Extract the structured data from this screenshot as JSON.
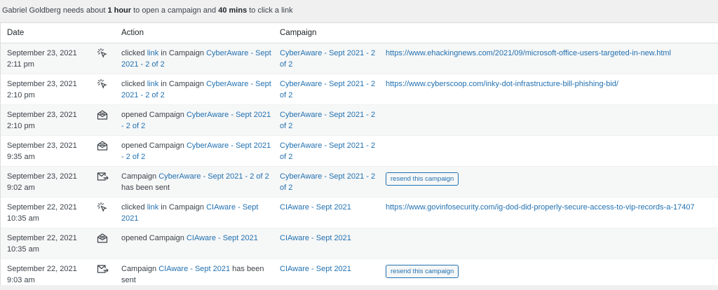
{
  "summary": {
    "prefix": "Gabriel Goldberg needs about ",
    "open_time": "1 hour",
    "middle": " to open a campaign and ",
    "click_time": "40 mins",
    "suffix": " to click a link"
  },
  "columns": {
    "date": "Date",
    "action": "Action",
    "campaign": "Campaign"
  },
  "rows": [
    {
      "date": "September 23, 2021",
      "time": "2:11 pm",
      "icon": "click-icon",
      "type": "click",
      "pre": "clicked ",
      "link_word": "link",
      "mid": " in Campaign ",
      "camp_link": "CyberAware - Sept 2021 - 2 of 2",
      "post": "",
      "campaign": "CyberAware - Sept 2021 - 2 of 2",
      "extra": "https://www.ehackingnews.com/2021/09/microsoft-office-users-targeted-in-new.html"
    },
    {
      "date": "September 23, 2021",
      "time": "2:10 pm",
      "icon": "click-icon",
      "type": "click",
      "pre": "clicked ",
      "link_word": "link",
      "mid": " in Campaign ",
      "camp_link": "CyberAware - Sept 2021 - 2 of 2",
      "post": "",
      "campaign": "CyberAware - Sept 2021 - 2 of 2",
      "extra": "https://www.cyberscoop.com/inky-dot-infrastructure-bill-phishing-bid/"
    },
    {
      "date": "September 23, 2021",
      "time": "2:10 pm",
      "icon": "open-envelope-icon",
      "type": "open",
      "pre": "opened Campaign ",
      "link_word": "",
      "mid": "",
      "camp_link": "CyberAware - Sept 2021 - 2 of 2",
      "post": "",
      "campaign": "CyberAware - Sept 2021 - 2 of 2",
      "extra": ""
    },
    {
      "date": "September 23, 2021",
      "time": "9:35 am",
      "icon": "open-envelope-icon",
      "type": "open",
      "pre": "opened Campaign ",
      "link_word": "",
      "mid": "",
      "camp_link": "CyberAware - Sept 2021 - 2 of 2",
      "post": "",
      "campaign": "CyberAware - Sept 2021 - 2 of 2",
      "extra": ""
    },
    {
      "date": "September 23, 2021",
      "time": "9:02 am",
      "icon": "send-envelope-icon",
      "type": "sent",
      "pre": "Campaign ",
      "link_word": "",
      "mid": "",
      "camp_link": "CyberAware - Sept 2021 - 2 of 2",
      "post": " has been sent",
      "campaign": "CyberAware - Sept 2021 - 2 of 2",
      "extra": "resend this campaign"
    },
    {
      "date": "September 22, 2021",
      "time": "10:35 am",
      "icon": "click-icon",
      "type": "click",
      "pre": "clicked ",
      "link_word": "link",
      "mid": " in Campaign ",
      "camp_link": "CIAware - Sept 2021",
      "post": "",
      "campaign": "CIAware - Sept 2021",
      "extra": "https://www.govinfosecurity.com/ig-dod-did-properly-secure-access-to-vip-records-a-17407"
    },
    {
      "date": "September 22, 2021",
      "time": "10:35 am",
      "icon": "open-envelope-icon",
      "type": "open",
      "pre": "opened Campaign ",
      "link_word": "",
      "mid": "",
      "camp_link": "CIAware - Sept 2021",
      "post": "",
      "campaign": "CIAware - Sept 2021",
      "extra": ""
    },
    {
      "date": "September 22, 2021",
      "time": "9:03 am",
      "icon": "send-envelope-icon",
      "type": "sent",
      "pre": "Campaign ",
      "link_word": "",
      "mid": "",
      "camp_link": "CIAware - Sept 2021",
      "post": " has been sent",
      "campaign": "CIAware - Sept 2021",
      "extra": "resend this campaign"
    }
  ]
}
